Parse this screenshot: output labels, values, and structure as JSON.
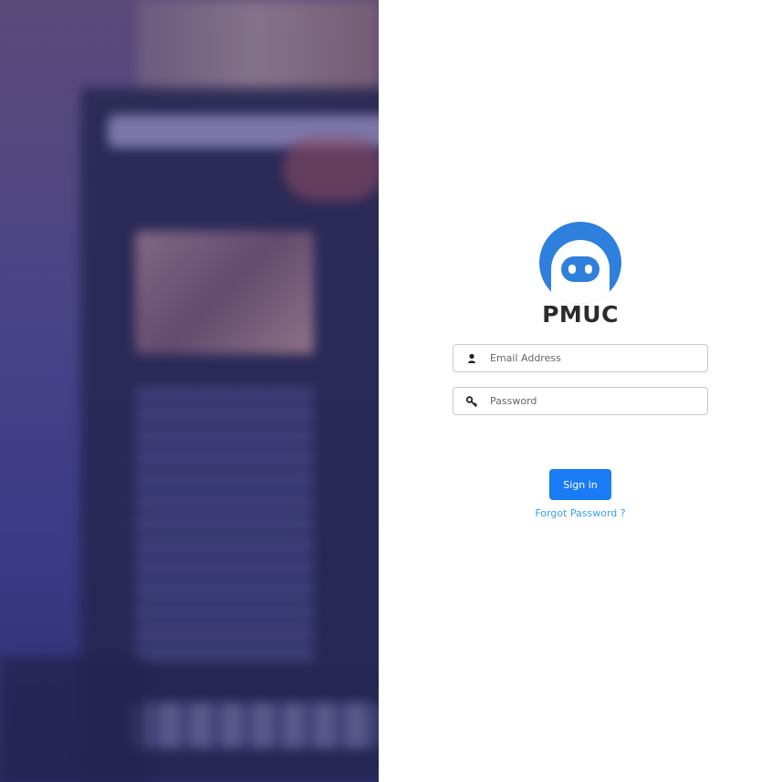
{
  "brand": {
    "title": "PMUC",
    "logo_icon": "robot-icon",
    "logo_color": "#2f7fdc"
  },
  "form": {
    "email": {
      "placeholder": "Email Address",
      "value": "",
      "icon": "user-icon"
    },
    "password": {
      "placeholder": "Password",
      "value": "",
      "icon": "key-icon"
    },
    "signin_label": "Sign in",
    "forgot_label": "Forgot Password ?"
  },
  "colors": {
    "primary": "#1a7cf5",
    "link": "#35a2ee",
    "side_panel": "#3b3a86"
  }
}
